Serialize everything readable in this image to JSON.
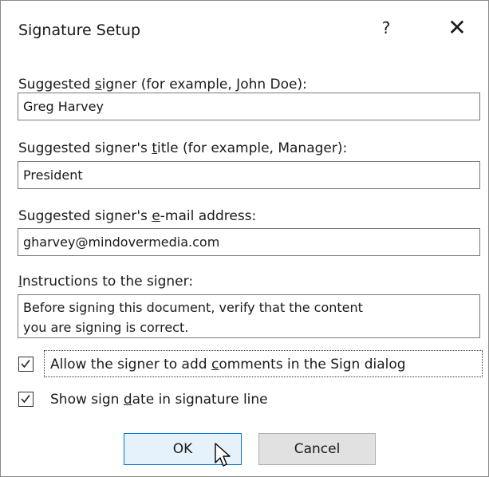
{
  "dialog": {
    "title": "Signature Setup",
    "help_label": "?",
    "close_label": "✕"
  },
  "fields": {
    "signer": {
      "label_pre": "Suggested ",
      "label_key": "s",
      "label_post": "igner (for example, John Doe):",
      "value": "Greg Harvey"
    },
    "title": {
      "label_pre": "Suggested signer's ",
      "label_key": "t",
      "label_post": "itle (for example, Manager):",
      "value": "President"
    },
    "email": {
      "label_pre": "Suggested signer's ",
      "label_key": "e",
      "label_post": "-mail address:",
      "value": "gharvey@mindovermedia.com"
    },
    "instructions": {
      "label_key": "I",
      "label_post": "nstructions to the signer:",
      "line1": "Before signing this document, verify that the content",
      "line2": "you are signing is correct."
    }
  },
  "checkboxes": {
    "allow_comments": {
      "label_pre": "Allow the signer to add ",
      "label_key": "c",
      "label_post": "omments in the Sign dialog",
      "checked": true
    },
    "show_date": {
      "label_pre": "Show sign ",
      "label_key": "d",
      "label_post": "ate in signature line",
      "checked": true
    }
  },
  "buttons": {
    "ok_label": "OK",
    "cancel_label": "Cancel"
  },
  "colors": {
    "ok_border": "#0078d7",
    "ok_bg": "#e5f1fb",
    "cancel_bg": "#e1e1e1"
  }
}
